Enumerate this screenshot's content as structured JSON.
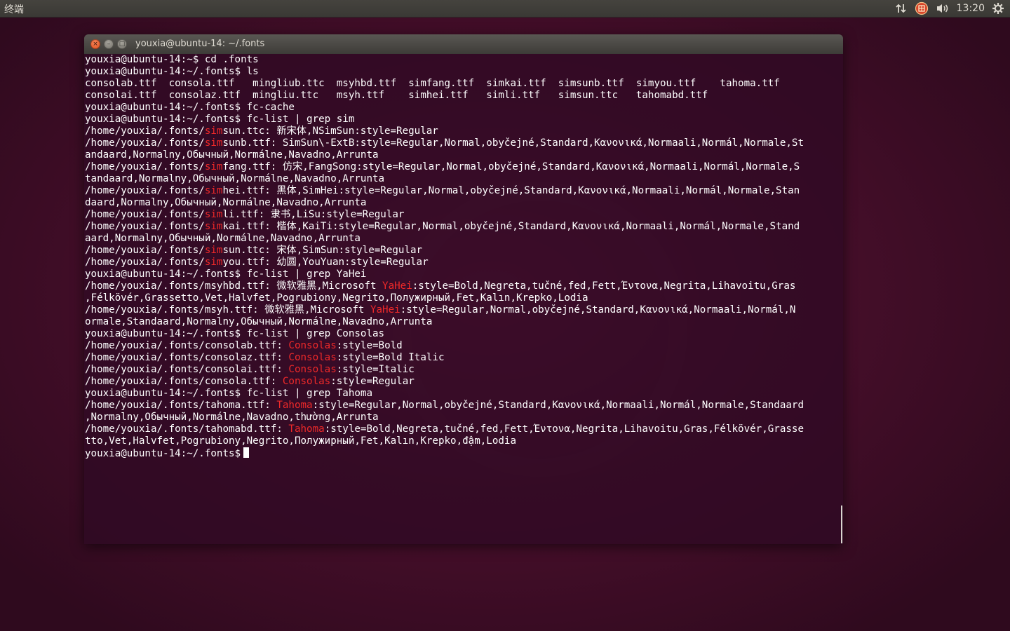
{
  "panel": {
    "app_title": "终端",
    "clock": "13:20",
    "icons": [
      "network-transfer-icon",
      "input-method-icon",
      "volume-icon",
      "system-gear-icon"
    ]
  },
  "window": {
    "title": "youxia@ubuntu-14: ~/.fonts",
    "buttons": {
      "close": "×",
      "minimize": "–",
      "maximize": "□"
    }
  },
  "terminal": {
    "colors": {
      "background": "#300a24",
      "foreground": "#ffffff",
      "match": "#ef2929"
    },
    "lines": [
      [
        "youxia@ubuntu-14:~$ cd .fonts"
      ],
      [
        "youxia@ubuntu-14:~/.fonts$ ls"
      ],
      [
        "consolab.ttf  consola.ttf   mingliub.ttc  msyhbd.ttf  simfang.ttf  simkai.ttf  simsunb.ttf  simyou.ttf    tahoma.ttf"
      ],
      [
        "consolai.ttf  consolaz.ttf  mingliu.ttc   msyh.ttf    simhei.ttf   simli.ttf   simsun.ttc   tahomabd.ttf"
      ],
      [
        "youxia@ubuntu-14:~/.fonts$ fc-cache"
      ],
      [
        "youxia@ubuntu-14:~/.fonts$ fc-list | grep sim"
      ],
      [
        "/home/youxia/.fonts/",
        "sim",
        "sun.ttc: 新宋体,NSimSun:style=Regular"
      ],
      [
        "/home/youxia/.fonts/",
        "sim",
        "sunb.ttf: SimSun\\-ExtB:style=Regular,Normal,obyčejné,Standard,Κανονικά,Normaali,Normál,Normale,St"
      ],
      [
        "andaard,Normalny,Обычный,Normálne,Navadno,Arrunta"
      ],
      [
        "/home/youxia/.fonts/",
        "sim",
        "fang.ttf: 仿宋,FangSong:style=Regular,Normal,obyčejné,Standard,Κανονικά,Normaali,Normál,Normale,S"
      ],
      [
        "tandaard,Normalny,Обычный,Normálne,Navadno,Arrunta"
      ],
      [
        "/home/youxia/.fonts/",
        "sim",
        "hei.ttf: 黑体,SimHei:style=Regular,Normal,obyčejné,Standard,Κανονικά,Normaali,Normál,Normale,Stan"
      ],
      [
        "daard,Normalny,Обычный,Normálne,Navadno,Arrunta"
      ],
      [
        "/home/youxia/.fonts/",
        "sim",
        "li.ttf: 隶书,LiSu:style=Regular"
      ],
      [
        "/home/youxia/.fonts/",
        "sim",
        "kai.ttf: 楷体,KaiTi:style=Regular,Normal,obyčejné,Standard,Κανονικά,Normaali,Normál,Normale,Stand"
      ],
      [
        "aard,Normalny,Обычный,Normálne,Navadno,Arrunta"
      ],
      [
        "/home/youxia/.fonts/",
        "sim",
        "sun.ttc: 宋体,SimSun:style=Regular"
      ],
      [
        "/home/youxia/.fonts/",
        "sim",
        "you.ttf: 幼圆,YouYuan:style=Regular"
      ],
      [
        "youxia@ubuntu-14:~/.fonts$ fc-list | grep YaHei"
      ],
      [
        "/home/youxia/.fonts/msyhbd.ttf: 微软雅黑,Microsoft ",
        "YaHei",
        ":style=Bold,Negreta,tučné,fed,Fett,Έντονα,Negrita,Lihavoitu,Gras"
      ],
      [
        ",Félkövér,Grassetto,Vet,Halvfet,Pogrubiony,Negrito,Полужирный,Fet,Kalın,Krepko,Lodia"
      ],
      [
        "/home/youxia/.fonts/msyh.ttf: 微软雅黑,Microsoft ",
        "YaHei",
        ":style=Regular,Normal,obyčejné,Standard,Κανονικά,Normaali,Normál,N"
      ],
      [
        "ormale,Standaard,Normalny,Обычный,Normálne,Navadno,Arrunta"
      ],
      [
        "youxia@ubuntu-14:~/.fonts$ fc-list | grep Consolas"
      ],
      [
        "/home/youxia/.fonts/consolab.ttf: ",
        "Consolas",
        ":style=Bold"
      ],
      [
        "/home/youxia/.fonts/consolaz.ttf: ",
        "Consolas",
        ":style=Bold Italic"
      ],
      [
        "/home/youxia/.fonts/consolai.ttf: ",
        "Consolas",
        ":style=Italic"
      ],
      [
        "/home/youxia/.fonts/consola.ttf: ",
        "Consolas",
        ":style=Regular"
      ],
      [
        "youxia@ubuntu-14:~/.fonts$ fc-list | grep Tahoma"
      ],
      [
        "/home/youxia/.fonts/tahoma.ttf: ",
        "Tahoma",
        ":style=Regular,Normal,obyčejné,Standard,Κανονικά,Normaali,Normál,Normale,Standaard"
      ],
      [
        ",Normalny,Обычный,Normálne,Navadno,thường,Arrunta"
      ],
      [
        "/home/youxia/.fonts/tahomabd.ttf: ",
        "Tahoma",
        ":style=Bold,Negreta,tučné,fed,Fett,Έντονα,Negrita,Lihavoitu,Gras,Félkövér,Grasse"
      ],
      [
        "tto,Vet,Halvfet,Pogrubiony,Negrito,Полужирный,Fet,Kalın,Krepko,đậm,Lodia"
      ]
    ],
    "prompt": "youxia@ubuntu-14:~/.fonts$"
  }
}
